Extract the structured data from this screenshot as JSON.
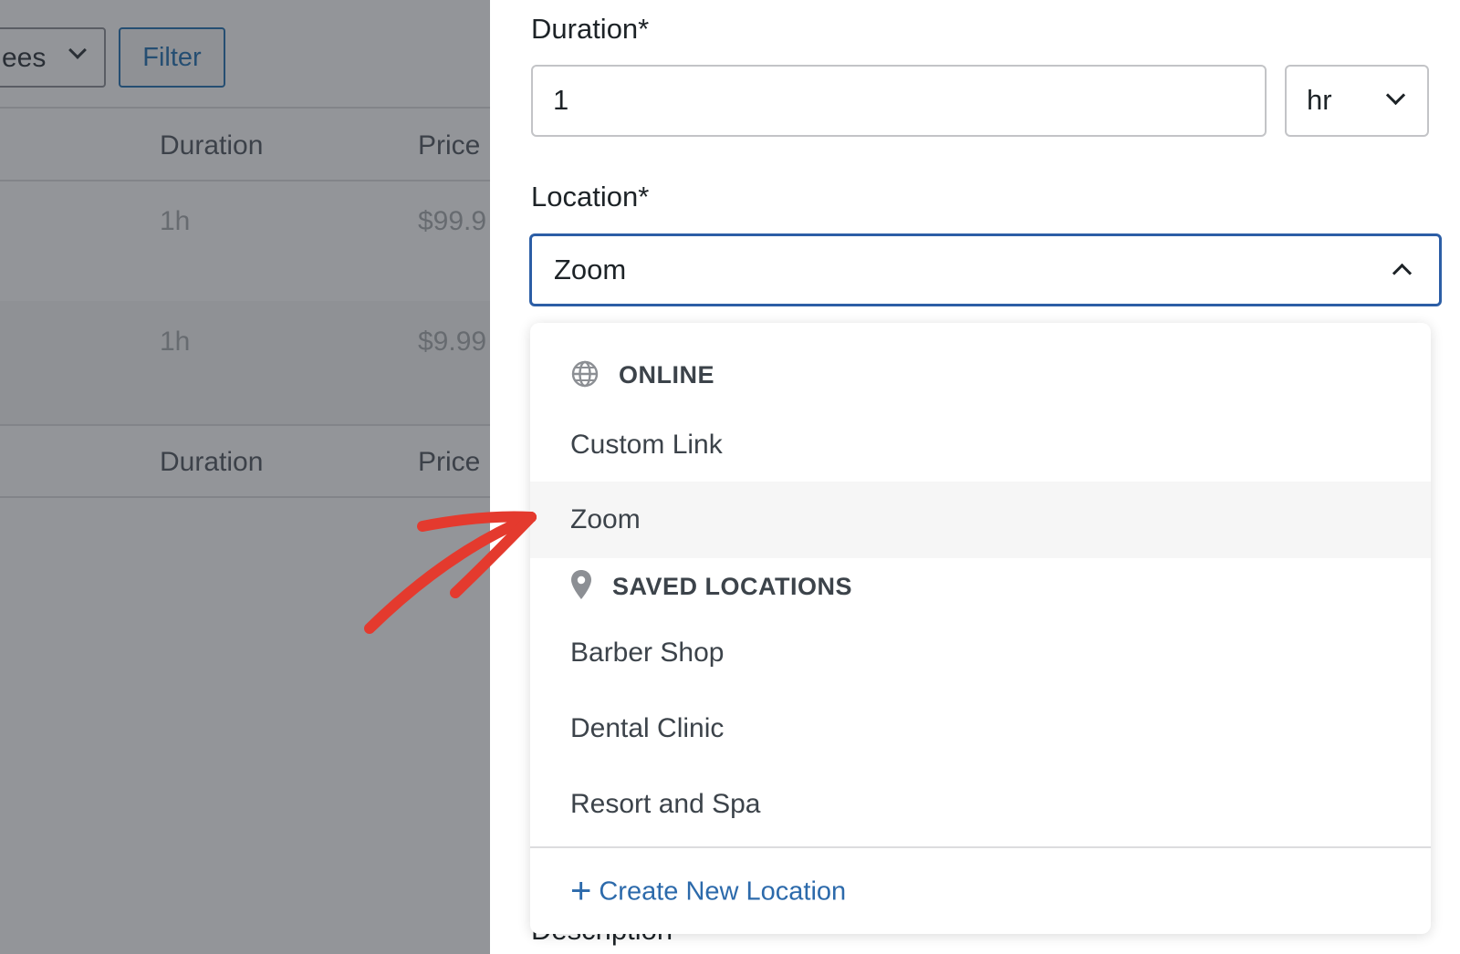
{
  "background": {
    "attendees_select": "ees",
    "filter_button": "Filter",
    "table1": {
      "headers": [
        "Duration",
        "Price"
      ],
      "rows": [
        {
          "duration": "1h",
          "price": "$99.9"
        },
        {
          "duration": "1h",
          "price": "$9.99"
        }
      ]
    },
    "table2": {
      "headers": [
        "Duration",
        "Price"
      ]
    }
  },
  "form": {
    "duration": {
      "label": "Duration*",
      "value": "1",
      "unit": "hr"
    },
    "location": {
      "label": "Location*",
      "value": "Zoom",
      "expanded": true
    },
    "description_label": "Description"
  },
  "location_dropdown": {
    "groups": [
      {
        "header": "ONLINE",
        "icon": "globe-icon",
        "options": [
          "Custom Link",
          "Zoom"
        ]
      },
      {
        "header": "SAVED LOCATIONS",
        "icon": "map-pin-icon",
        "options": [
          "Barber Shop",
          "Dental Clinic",
          "Resort and Spa"
        ]
      }
    ],
    "highlighted_option": "Zoom",
    "create_label": "Create New Location"
  },
  "annotation": {
    "arrow_color": "#e43a2e"
  },
  "colors": {
    "accent": "#2271b1",
    "focus_border": "#2c5ea6",
    "link": "#2c6aab"
  }
}
